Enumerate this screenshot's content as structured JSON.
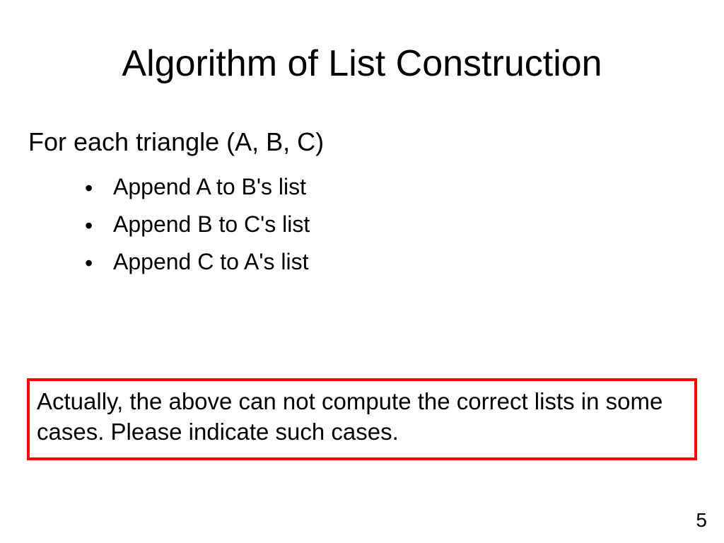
{
  "title": "Algorithm of List Construction",
  "intro": "For each triangle (A, B, C)",
  "bullets": [
    "Append A to B's list",
    "Append B to C's list",
    "Append C to A's list"
  ],
  "note": "Actually, the above can not compute the correct lists in some cases. Please indicate such cases.",
  "pageNumber": "5"
}
